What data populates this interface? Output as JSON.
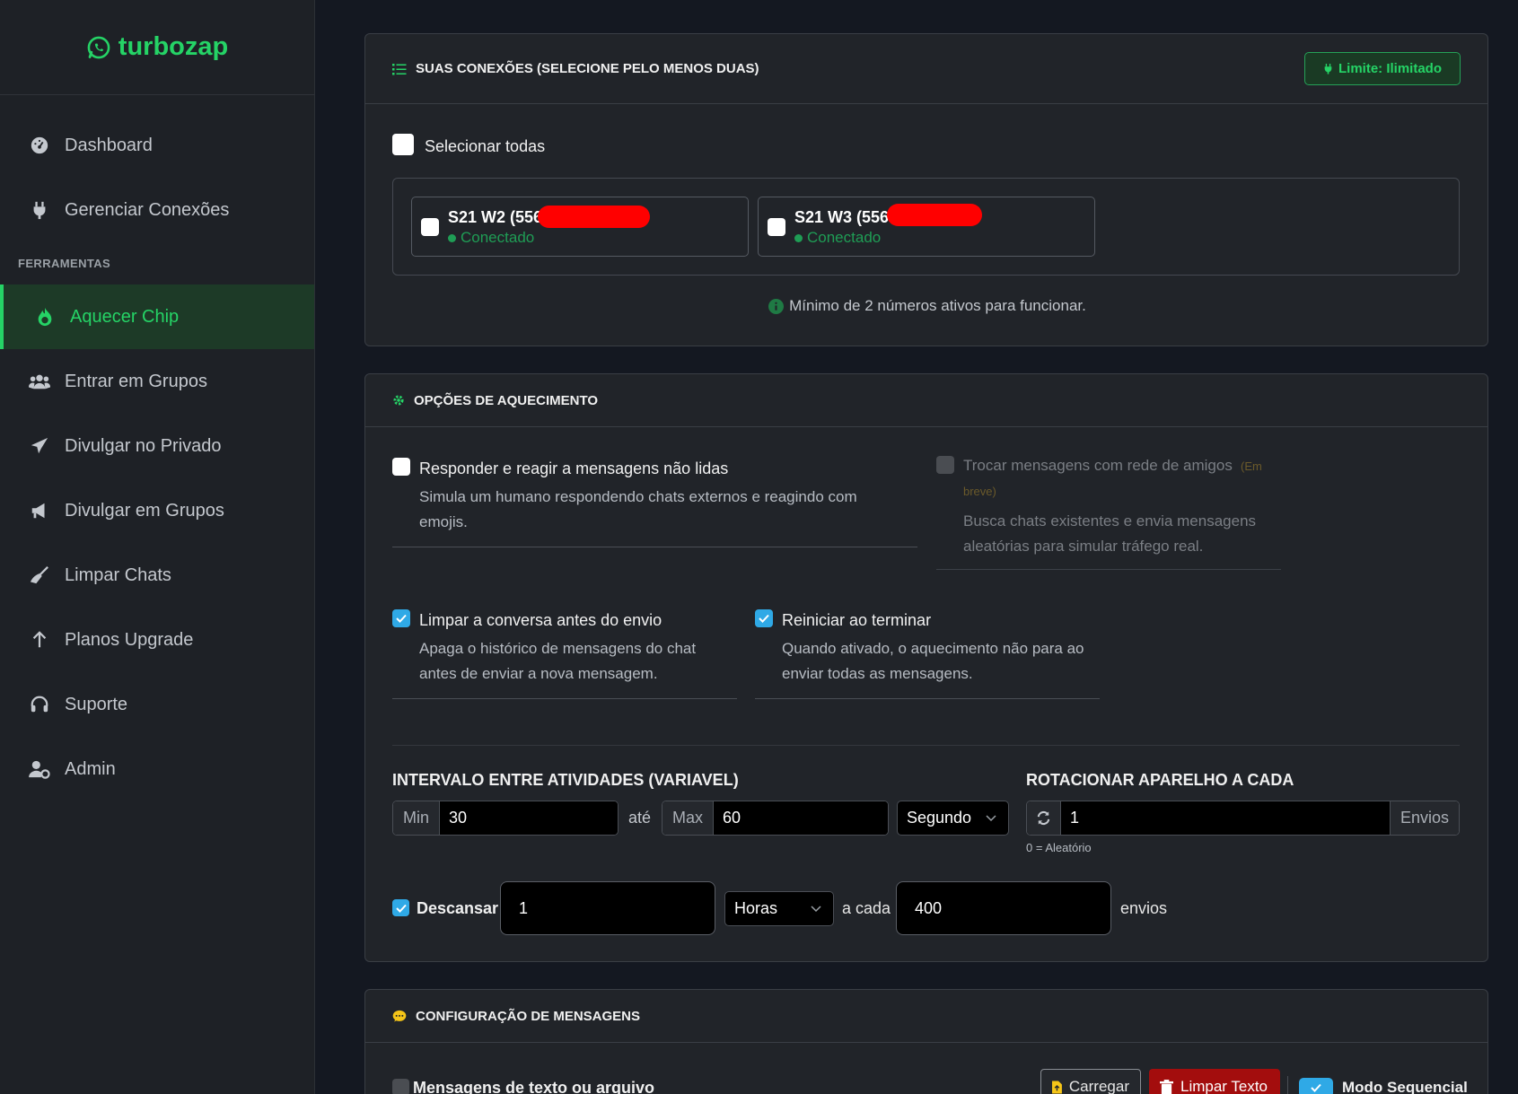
{
  "brand": {
    "name": "turbozap",
    "color": "#25d366"
  },
  "sidebar": {
    "items_top": [
      {
        "label": "Dashboard",
        "icon": "gauge-icon"
      },
      {
        "label": "Gerenciar Conexões",
        "icon": "plug-icon"
      }
    ],
    "section_label": "FERRAMENTAS",
    "items_tools": [
      {
        "label": "Aquecer Chip",
        "icon": "fire-icon",
        "active": true
      },
      {
        "label": "Entrar em Grupos",
        "icon": "users-icon"
      },
      {
        "label": "Divulgar no Privado",
        "icon": "paper-plane-icon"
      },
      {
        "label": "Divulgar em Grupos",
        "icon": "megaphone-icon"
      },
      {
        "label": "Limpar Chats",
        "icon": "broom-icon"
      },
      {
        "label": "Planos Upgrade",
        "icon": "arrow-up-icon"
      },
      {
        "label": "Suporte",
        "icon": "headset-icon"
      },
      {
        "label": "Admin",
        "icon": "user-gear-icon"
      }
    ]
  },
  "connections": {
    "title": "SUAS CONEXÕES (SELECIONE PELO MENOS DUAS)",
    "limit_badge": "Limite: Ilimitado",
    "select_all": "Selecionar todas",
    "items": [
      {
        "name": "S21 W2 (5567",
        "status": "Conectado"
      },
      {
        "name": "S21 W3 (556",
        "status": "Conectado"
      }
    ],
    "min_note": "Mínimo de 2 números ativos para funcionar."
  },
  "options": {
    "title": "OPÇÕES DE AQUECIMENTO",
    "respond": {
      "title": "Responder e reagir a mensagens não lidas",
      "desc1": "Simula um humano respondendo chats externos e reagindo com",
      "desc2": "emojis."
    },
    "friends": {
      "title": "Trocar mensagens com rede de amigos",
      "soon1": "(Em",
      "soon2": "breve)",
      "desc1": "Busca chats existentes e envia mensagens",
      "desc2": "aleatórias para simular tráfego real."
    },
    "clear": {
      "title": "Limpar a conversa antes do envio",
      "desc1": "Apaga o histórico de mensagens do chat",
      "desc2": "antes de enviar a nova mensagem."
    },
    "restart": {
      "title": "Reiniciar ao terminar",
      "desc1": "Quando ativado, o aquecimento não para ao",
      "desc2": "enviar todas as mensagens."
    },
    "interval": {
      "label": "INTERVALO ENTRE ATIVIDADES (VARIAVEL)",
      "min_addon": "Min",
      "min_value": "30",
      "ate": "até",
      "max_addon": "Max",
      "max_value": "60",
      "unit": "Segundo"
    },
    "rotate": {
      "label": "ROTACIONAR APARELHO A CADA",
      "value": "1",
      "suffix": "Envios",
      "hint": "0 = Aleatório"
    },
    "rest": {
      "label": "Descansar",
      "value": "1",
      "unit": "Horas",
      "a_cada": "a cada",
      "count": "400",
      "suffix": "envios"
    }
  },
  "messages": {
    "title": "CONFIGURAÇÃO DE MENSAGENS",
    "text_or_file": "Mensagens de texto ou arquivo",
    "load": "Carregar",
    "clear_text": "Limpar Texto",
    "sequential": "Modo Sequencial"
  },
  "colors": {
    "accent": "#25d366",
    "check": "#2fa9e6",
    "danger": "#a30d0d",
    "redaction": "#ff0000"
  }
}
